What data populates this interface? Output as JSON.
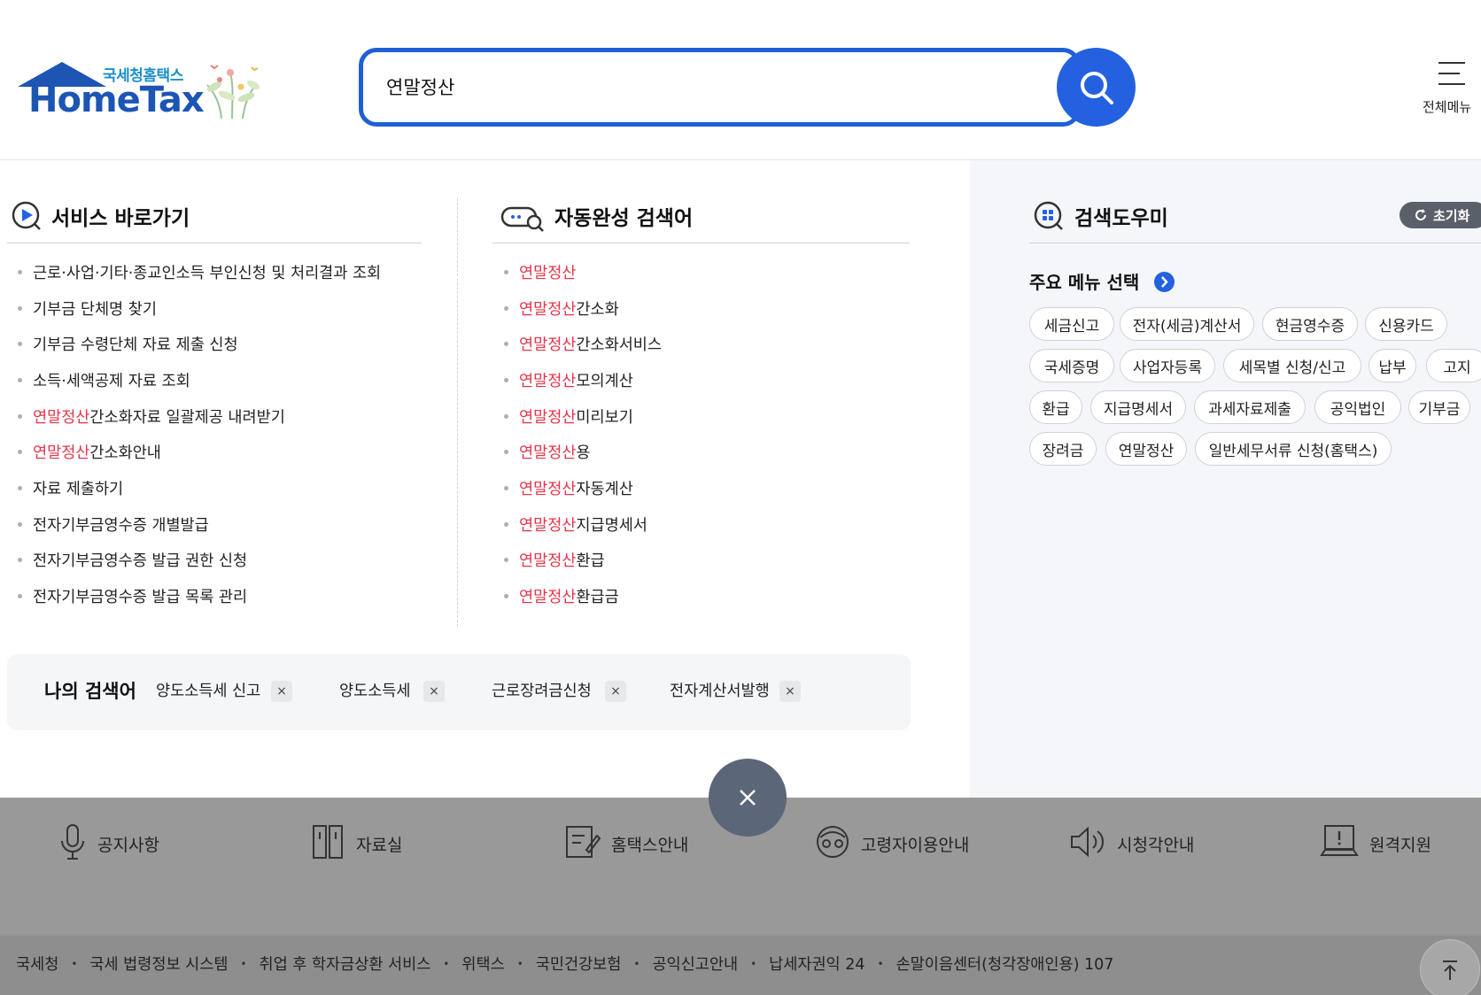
{
  "logo": {
    "sub": "국세청홈택스",
    "main": "HomeTax"
  },
  "search": {
    "value": "연말정산"
  },
  "header": {
    "allmenu_label": "전체메뉴"
  },
  "service": {
    "title": "서비스 바로가기",
    "items": [
      {
        "pre": "",
        "hl": "",
        "post": "근로·사업·기타·종교인소득 부인신청 및 처리결과 조회"
      },
      {
        "pre": "",
        "hl": "",
        "post": "기부금 단체명 찾기"
      },
      {
        "pre": "",
        "hl": "",
        "post": "기부금 수령단체 자료 제출 신청"
      },
      {
        "pre": "",
        "hl": "",
        "post": "소득·세액공제 자료 조회"
      },
      {
        "pre": "",
        "hl": "연말정산",
        "post": " 간소화자료 일괄제공 내려받기"
      },
      {
        "pre": "",
        "hl": "연말정산",
        "post": "간소화안내"
      },
      {
        "pre": "",
        "hl": "",
        "post": "자료 제출하기"
      },
      {
        "pre": "",
        "hl": "",
        "post": "전자기부금영수증 개별발급"
      },
      {
        "pre": "",
        "hl": "",
        "post": "전자기부금영수증 발급 권한 신청"
      },
      {
        "pre": "",
        "hl": "",
        "post": "전자기부금영수증 발급 목록 관리"
      }
    ]
  },
  "autocomplete": {
    "title": "자동완성 검색어",
    "items": [
      {
        "hl": "연말정산",
        "post": ""
      },
      {
        "hl": "연말정산",
        "post": "간소화"
      },
      {
        "hl": "연말정산",
        "post": "간소화서비스"
      },
      {
        "hl": "연말정산",
        "post": "모의계산"
      },
      {
        "hl": "연말정산",
        "post": "미리보기"
      },
      {
        "hl": "연말정산",
        "post": "용"
      },
      {
        "hl": "연말정산",
        "post": "자동계산"
      },
      {
        "hl": "연말정산",
        "post": "지급명세서"
      },
      {
        "hl": "연말정산",
        "post": "환급"
      },
      {
        "hl": "연말정산",
        "post": "환급금"
      }
    ]
  },
  "helper": {
    "title": "검색도우미",
    "reset_label": "초기화",
    "subtitle": "주요 메뉴 선택",
    "chips": [
      "세금신고",
      "전자(세금)계산서",
      "현금영수증",
      "신용카드",
      "국세증명",
      "사업자등록",
      "세목별 신청/신고",
      "납부",
      "고지",
      "환급",
      "지급명세서",
      "과세자료제출",
      "공익법인",
      "기부금",
      "장려금",
      "연말정산",
      "일반세무서류 신청(홈택스)"
    ]
  },
  "my_search": {
    "title": "나의 검색어",
    "tags": [
      "양도소득세 신고",
      "양도소득세",
      "근로장려금신청",
      "전자계산서발행"
    ],
    "remove_glyph": "×"
  },
  "quick_links": [
    "공지사항",
    "자료실",
    "홈택스안내",
    "고령자이용안내",
    "시청각안내",
    "원격지원"
  ],
  "footer_links": [
    "국세청",
    "국세 법령정보 시스템",
    "취업 후 학자금상환 서비스",
    "위택스",
    "국민건강보험",
    "공익신고안내",
    "납세자권익 24",
    "손말이음센터(청각장애인용) 107"
  ],
  "colors": {
    "accent": "#2461e0",
    "highlight": "#e5344a",
    "overlay": "#999999"
  }
}
